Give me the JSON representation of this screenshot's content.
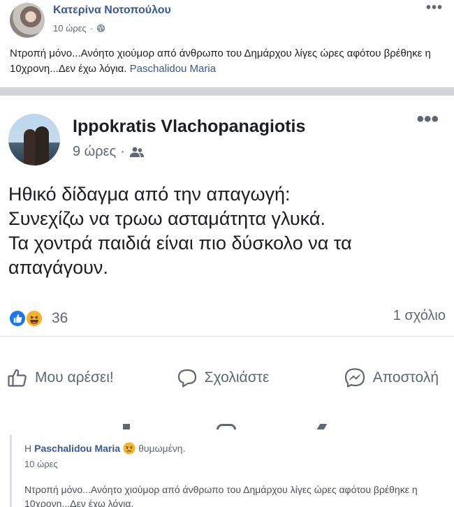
{
  "top_post": {
    "author": "Κατερίνα Νοτοπούλου",
    "time": "10 ώρες",
    "separator_dot": "·",
    "privacy_icon": "globe-icon",
    "more": "•••",
    "text": "Ντροπή μόνο...Ανόητο χιούμορ από άνθρωπο του Δημάρχου λίγες ώρες αφότου βρέθηκε η 10χρονη...Δεν έχω λόγια. ",
    "mention": "Paschalidou Maria"
  },
  "shared_post": {
    "author": "Ippokratis Vlachopanagiotis",
    "time": "9 ώρες",
    "separator_dot": "·",
    "privacy_icon": "friends-icon",
    "more": "•••",
    "lines": [
      "Ηθικό δίδαγμα από την απαγωγή:",
      "Συνεχίζω να τρωω ασταμάτητα γλυκά.",
      "Τα χοντρά παιδιά είναι πιο δύσκολο να τα",
      "απαγάγουν."
    ],
    "reactions": {
      "icons": [
        "like-reaction-icon",
        "haha-reaction-icon"
      ],
      "count": "36"
    },
    "comments": "1 σχόλιο",
    "actions": {
      "like": "Μου αρέσει!",
      "comment": "Σχολιάστε",
      "send": "Αποστολή"
    }
  },
  "attribution": {
    "prefix": "Η",
    "name": "Paschalidou Maria",
    "feeling": "θυμωμένη.",
    "time": "10 ώρες",
    "text": "Ντροπή μόνο...Ανόητο χιούμορ από άνθρωπο του Δημάρχου λίγες ώρες αφότου βρέθηκε η 10χρονη...Δεν έχω λόγια."
  },
  "colors": {
    "link": "#385898",
    "like_blue": "#1877f2",
    "haha_yellow": "#f7b125",
    "separator": "#d3d4d8"
  }
}
